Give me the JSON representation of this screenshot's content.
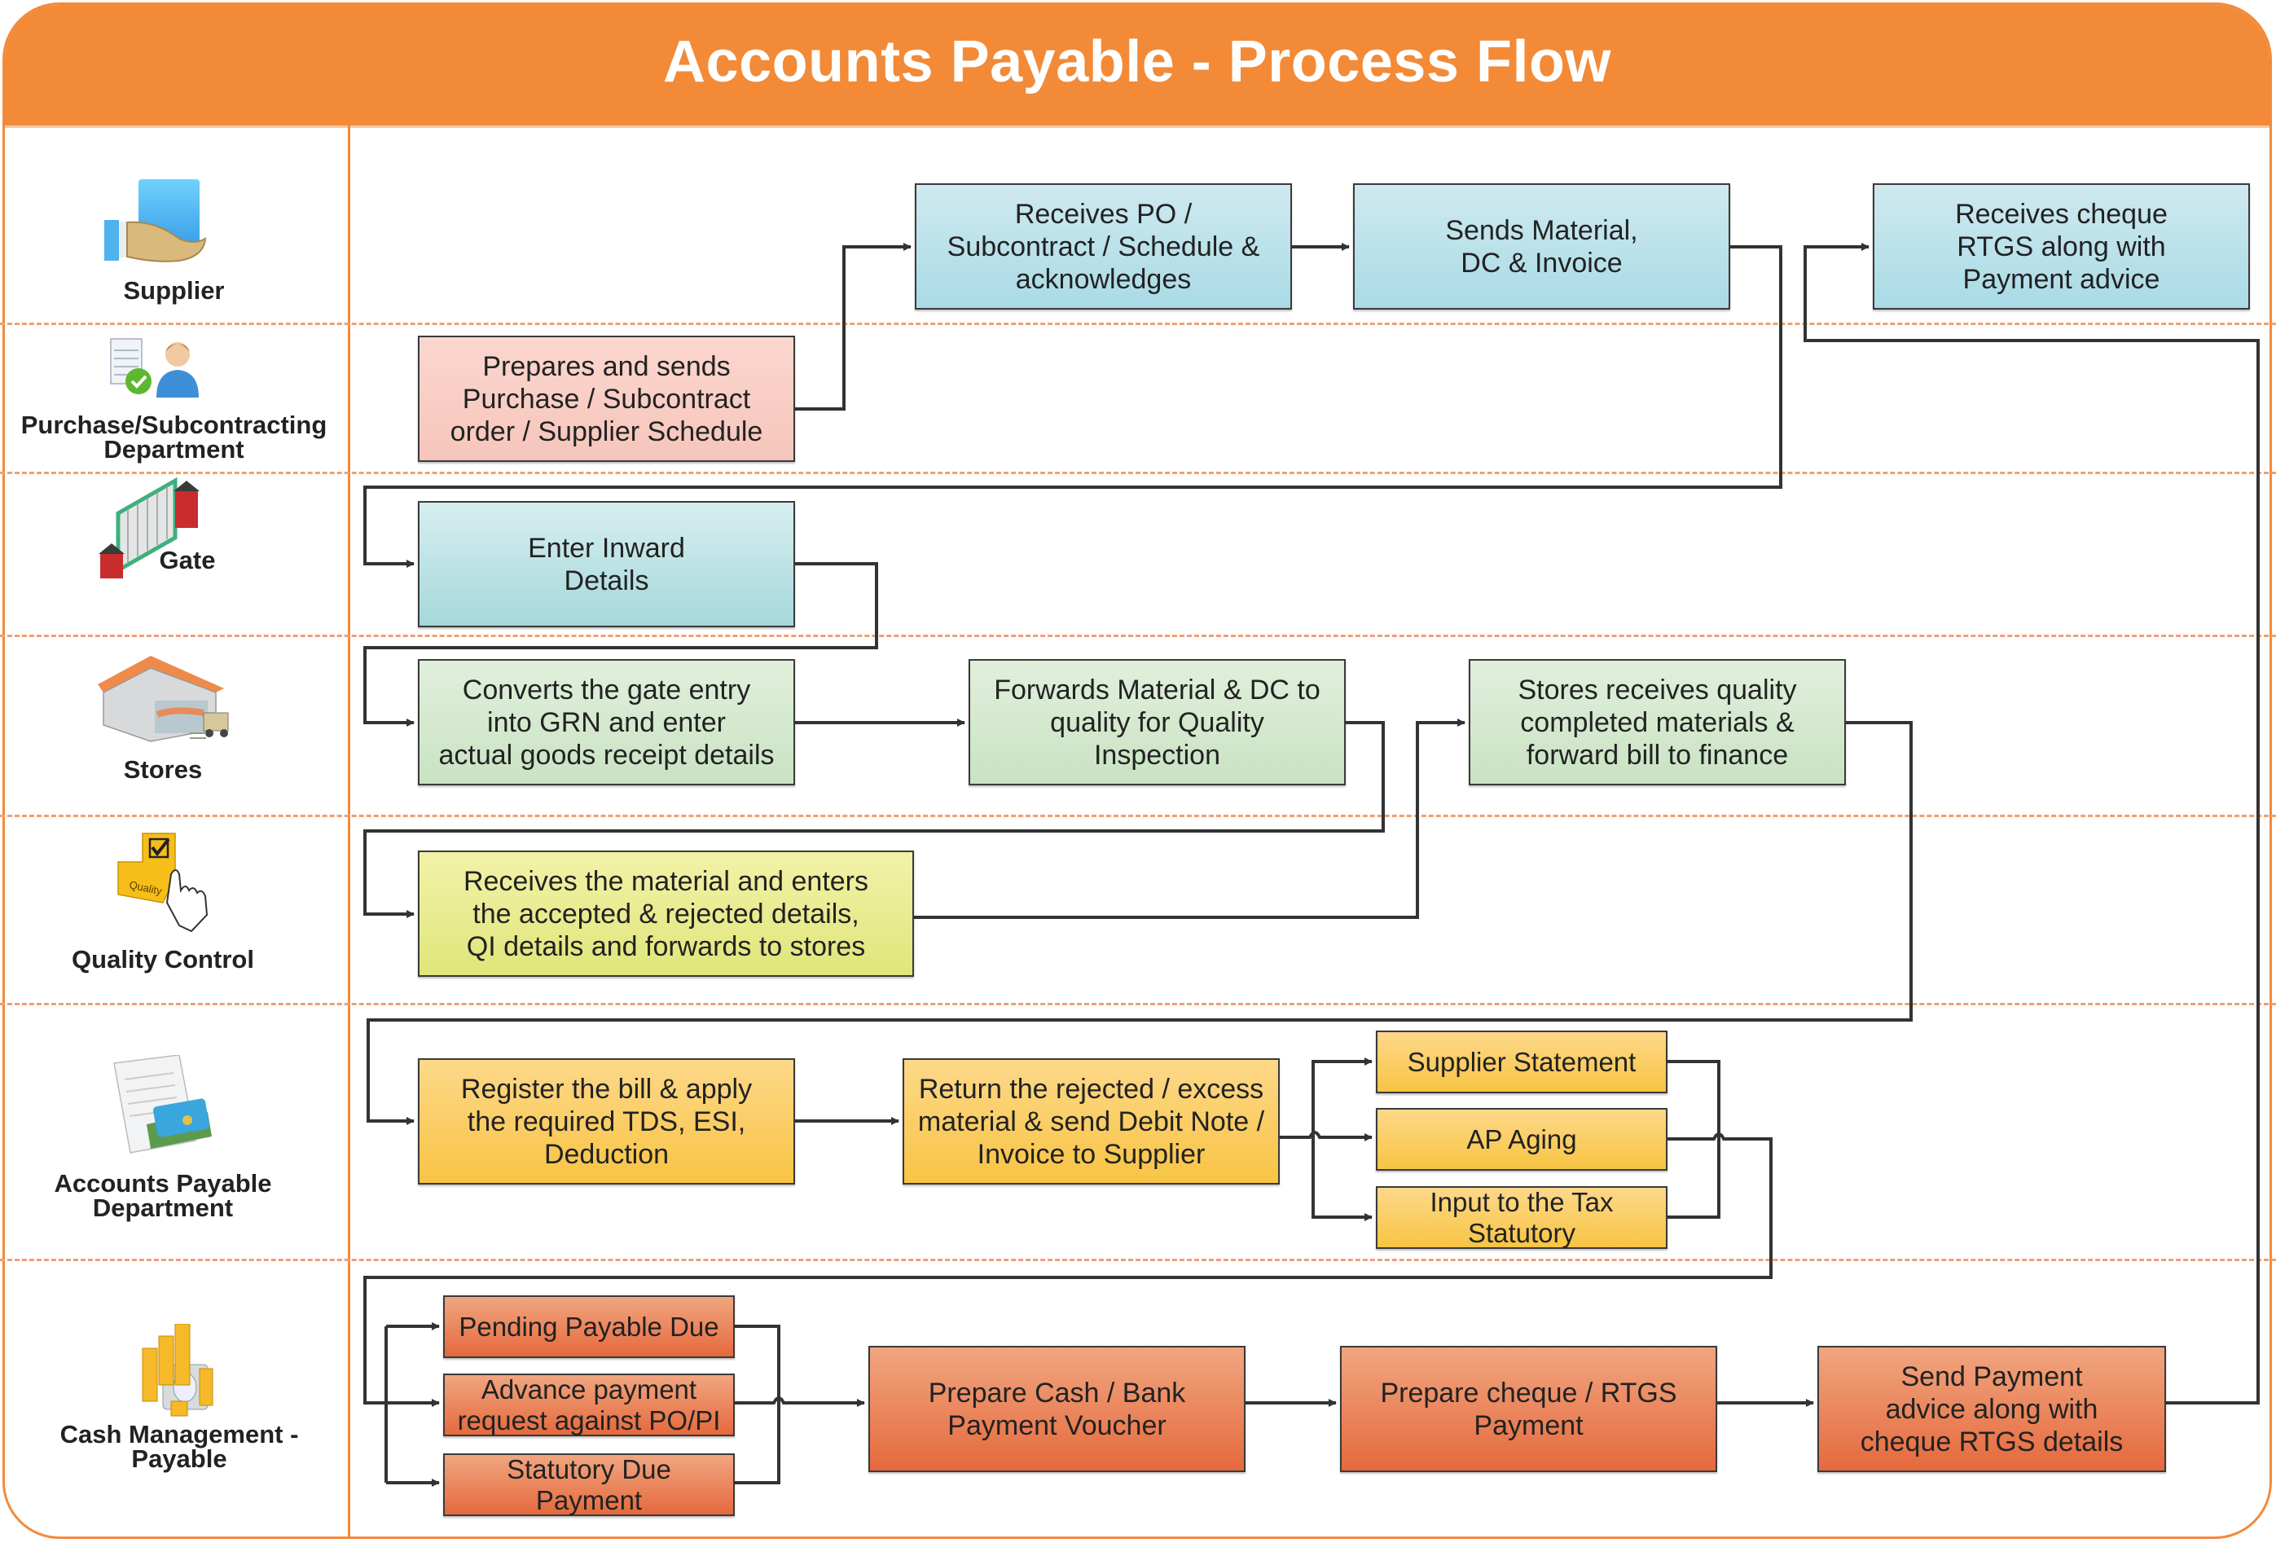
{
  "title": "Accounts Payable - Process Flow",
  "colors": {
    "header": "#f28a37",
    "lane_border": "#f28a3c",
    "connector": "#333333"
  },
  "lanes": [
    {
      "label": "Supplier",
      "icon": "supplier-hand-icon"
    },
    {
      "label": "Purchase/Subcontracting\nDepartment",
      "icon": "purchase-person-icon"
    },
    {
      "label": "Gate",
      "icon": "gate-icon"
    },
    {
      "label": "Stores",
      "icon": "warehouse-icon"
    },
    {
      "label": "Quality Control",
      "icon": "quality-check-icon"
    },
    {
      "label": "Accounts Payable\nDepartment",
      "icon": "invoice-money-icon"
    },
    {
      "label": "Cash Management -\nPayable",
      "icon": "coins-icon"
    }
  ],
  "steps": {
    "receives_po": "Receives PO /\nSubcontract / Schedule &\nacknowledges",
    "sends_material": "Sends Material,\nDC & Invoice",
    "receives_cheque": "Receives cheque\nRTGS along with\nPayment advice",
    "prepares_po": "Prepares and sends\nPurchase / Subcontract\norder / Supplier Schedule",
    "enter_inward": "Enter Inward\nDetails",
    "converts_grn": "Converts the gate entry\ninto GRN and enter\nactual goods receipt details",
    "forwards_quality": "Forwards Material & DC to\nquality for Quality\nInspection",
    "stores_receives": "Stores receives quality\ncompleted materials &\nforward bill to finance",
    "qc_receives": "Receives the material and enters\nthe accepted & rejected details,\nQI details and forwards to stores",
    "register_bill": "Register the bill & apply\nthe required TDS, ESI,\nDeduction",
    "return_rejected": "Return the rejected / excess\nmaterial & send  Debit Note /\nInvoice to Supplier",
    "supplier_statement": "Supplier Statement",
    "ap_aging": "AP Aging",
    "input_tax": "Input to the Tax\nStatutory",
    "pending_payable": "Pending Payable Due",
    "advance_payment": "Advance payment\nrequest against PO/PI",
    "statutory_due": "Statutory Due\nPayment",
    "prepare_voucher": "Prepare Cash / Bank\nPayment Voucher",
    "prepare_cheque": "Prepare cheque / RTGS\nPayment",
    "send_advice": "Send Payment\nadvice along with\ncheque RTGS details"
  }
}
